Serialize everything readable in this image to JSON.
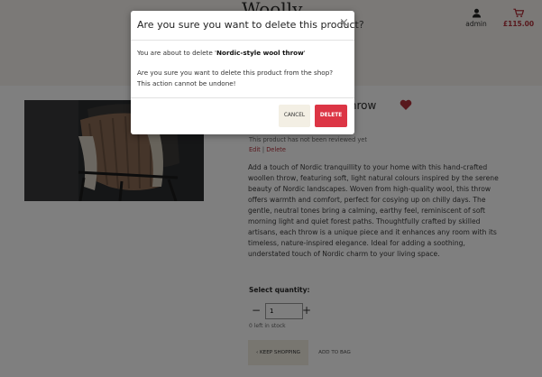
{
  "header": {
    "logo_text": "Woolly",
    "account_label": "admin",
    "bag_total": "£115.00"
  },
  "product": {
    "title": "Nordic-style wool throw",
    "review_note": "This product has not been reviewed yet",
    "edit_label": "Edit",
    "separator": "|",
    "delete_label": "Delete",
    "description": "Add a touch of Nordic tranquillity to your home with this hand-crafted woollen throw, featuring soft, light natural colours inspired by the serene beauty of Nordic landscapes. Woven from high-quality wool, this throw offers warmth and comfort, perfect for cosying up on chilly days. The gentle, neutral tones bring a calming, earthy feel, reminiscent of soft morning light and quiet forest paths. Thoughtfully crafted by skilled artisans, each throw is a unique piece and it enhances any room with its timeless, nature-inspired elegance. Ideal for adding a soothing, understated touch of Nordic charm to your living space.",
    "quantity_label": "Select quantity:",
    "quantity_value": "1",
    "minus_label": "−",
    "plus_label": "+",
    "stock_note": "0 left in stock",
    "keep_shopping_label": "‹ KEEP SHOPPING",
    "add_to_bag_label": "ADD TO BAG"
  },
  "modal": {
    "title": "Are you sure you want to delete this product?",
    "close_glyph": "×",
    "line1_prefix": "You are about to delete '",
    "line1_product": "Nordic-style wool throw",
    "line1_suffix": "'",
    "line2": "Are you sure you want to delete this product from the shop? This action cannot be undone!",
    "cancel_label": "CANCEL",
    "delete_label": "DELETE"
  },
  "colors": {
    "accent_red": "#dc3545",
    "brand_dark_red": "#b0303a",
    "cream": "#f3efe4",
    "overlay": "rgba(0,0,0,0.5)"
  }
}
